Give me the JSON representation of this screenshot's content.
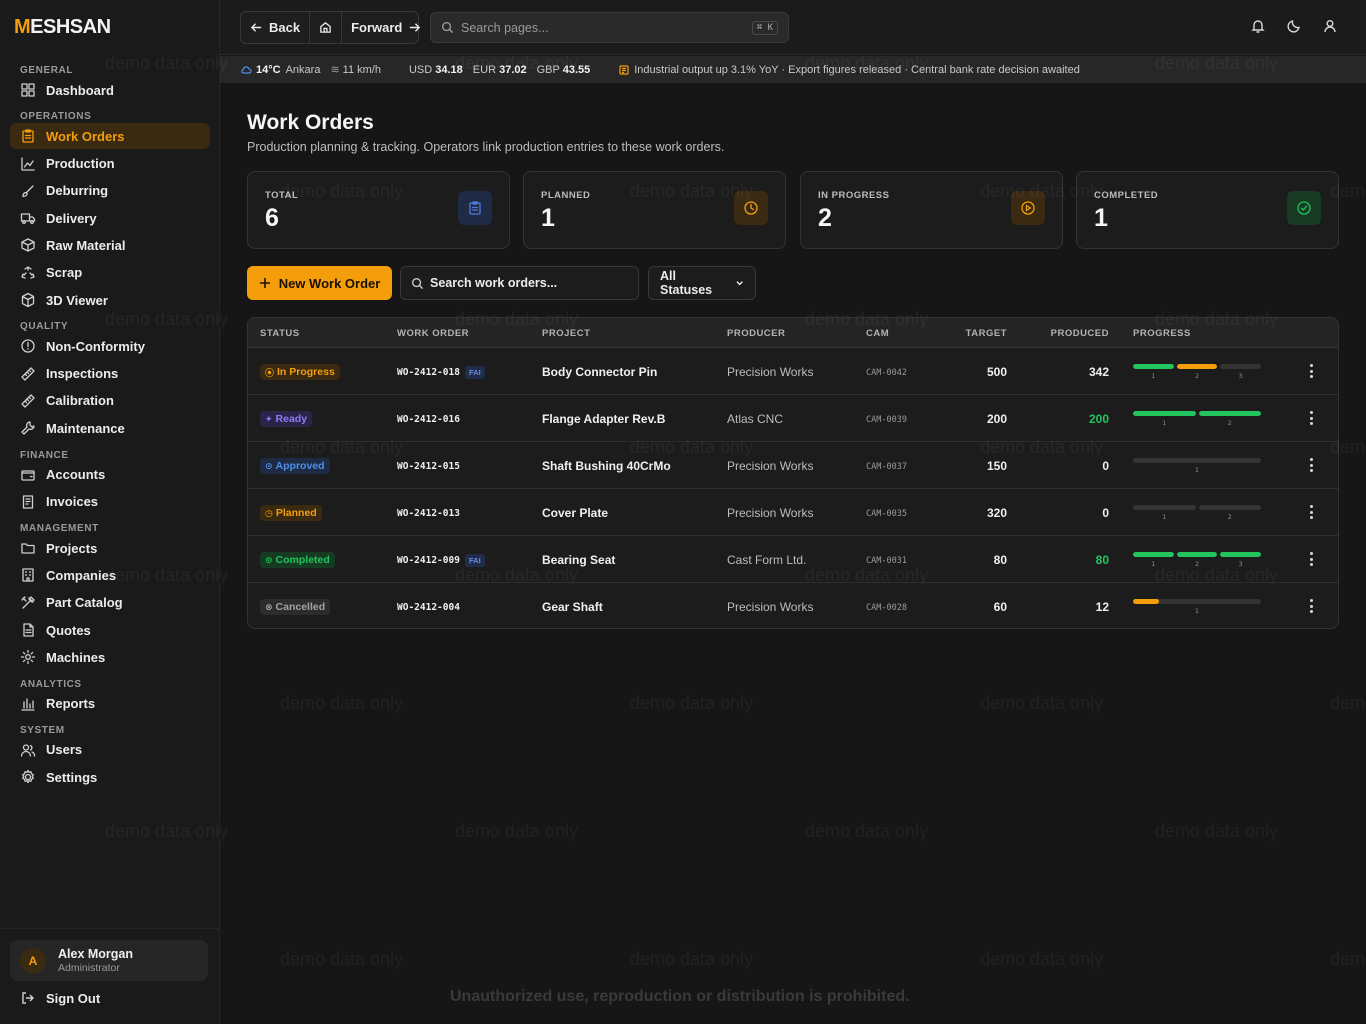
{
  "app": {
    "logo_prefix": "M",
    "logo_rest": "ESHSAN"
  },
  "sidebar": {
    "sections": [
      {
        "title": "GENERAL",
        "items": [
          {
            "label": "Dashboard",
            "icon": "dashboard-icon"
          }
        ]
      },
      {
        "title": "OPERATIONS",
        "items": [
          {
            "label": "Work Orders",
            "icon": "clipboard-icon",
            "active": true
          },
          {
            "label": "Production",
            "icon": "chart-icon"
          },
          {
            "label": "Deburring",
            "icon": "brush-icon"
          },
          {
            "label": "Delivery",
            "icon": "truck-icon"
          },
          {
            "label": "Raw Material",
            "icon": "box-icon"
          },
          {
            "label": "Scrap",
            "icon": "recycle-icon"
          },
          {
            "label": "3D Viewer",
            "icon": "cube-icon"
          }
        ]
      },
      {
        "title": "QUALITY",
        "items": [
          {
            "label": "Non-Conformity",
            "icon": "alert-circle-icon"
          },
          {
            "label": "Inspections",
            "icon": "ruler-icon"
          },
          {
            "label": "Calibration",
            "icon": "ruler-icon"
          },
          {
            "label": "Maintenance",
            "icon": "wrench-icon"
          }
        ]
      },
      {
        "title": "FINANCE",
        "items": [
          {
            "label": "Accounts",
            "icon": "wallet-icon"
          },
          {
            "label": "Invoices",
            "icon": "receipt-icon"
          }
        ]
      },
      {
        "title": "MANAGEMENT",
        "items": [
          {
            "label": "Projects",
            "icon": "folder-icon"
          },
          {
            "label": "Companies",
            "icon": "building-icon"
          },
          {
            "label": "Part Catalog",
            "icon": "tools-icon"
          },
          {
            "label": "Quotes",
            "icon": "file-icon"
          },
          {
            "label": "Machines",
            "icon": "cog-icon"
          }
        ]
      },
      {
        "title": "ANALYTICS",
        "items": [
          {
            "label": "Reports",
            "icon": "bar-chart-icon"
          }
        ]
      },
      {
        "title": "SYSTEM",
        "items": [
          {
            "label": "Users",
            "icon": "users-icon"
          },
          {
            "label": "Settings",
            "icon": "settings-icon"
          }
        ]
      }
    ],
    "user": {
      "initial": "A",
      "name": "Alex Morgan",
      "role": "Administrator"
    },
    "signout": "Sign Out"
  },
  "topbar": {
    "back": "Back",
    "forward": "Forward",
    "search_placeholder": "Search pages...",
    "shortcut": "⌘ K"
  },
  "ticker": {
    "temp": "14°C",
    "city": "Ankara",
    "wind": "11 km/h",
    "rates": [
      {
        "code": "USD",
        "value": "34.18"
      },
      {
        "code": "EUR",
        "value": "37.02"
      },
      {
        "code": "GBP",
        "value": "43.55"
      }
    ],
    "news": "Industrial output up 3.1% YoY · Export figures released · Central bank rate decision awaited"
  },
  "page": {
    "title": "Work Orders",
    "subtitle": "Production planning & tracking. Operators link production entries to these work orders."
  },
  "stats": [
    {
      "label": "TOTAL",
      "value": "6",
      "icon": "clipboard-icon",
      "color": "#4f7bdc",
      "bg": "#1f2a44"
    },
    {
      "label": "PLANNED",
      "value": "1",
      "icon": "clock-icon",
      "color": "#f59e0b",
      "bg": "#3a2a12"
    },
    {
      "label": "IN PROGRESS",
      "value": "2",
      "icon": "play-icon",
      "color": "#f59e0b",
      "bg": "#3a2a12"
    },
    {
      "label": "COMPLETED",
      "value": "1",
      "icon": "check-circle-icon",
      "color": "#22c55e",
      "bg": "#163a22"
    }
  ],
  "toolbar": {
    "new_label": "New Work Order",
    "search_placeholder": "Search work orders...",
    "status_filter": "All Statuses"
  },
  "table": {
    "headers": [
      "STATUS",
      "WORK ORDER",
      "PROJECT",
      "PRODUCER",
      "CAM",
      "TARGET",
      "PRODUCED",
      "PROGRESS"
    ],
    "rows": [
      {
        "status": "In Progress",
        "status_icon": "⦿",
        "status_color": "#f59e0b",
        "status_bg": "#3a2a12",
        "wo": "WO-2412-018",
        "fai": "FAI",
        "project": "Body Connector Pin",
        "producer": "Precision Works",
        "cam": "CAM-0042",
        "target": "500",
        "produced": "342",
        "produced_green": false,
        "segments": [
          {
            "n": "1",
            "fill": 1.0,
            "color": "#22c55e"
          },
          {
            "n": "2",
            "fill": 1.0,
            "color": "#f59e0b"
          },
          {
            "n": "3",
            "fill": 0,
            "color": "#343434"
          }
        ]
      },
      {
        "status": "Ready",
        "status_icon": "✦",
        "status_color": "#8b7cf6",
        "status_bg": "#2a2448",
        "wo": "WO-2412-016",
        "fai": "",
        "project": "Flange Adapter Rev.B",
        "producer": "Atlas CNC",
        "cam": "CAM-0039",
        "target": "200",
        "produced": "200",
        "produced_green": true,
        "segments": [
          {
            "n": "1",
            "fill": 1.0,
            "color": "#22c55e"
          },
          {
            "n": "2",
            "fill": 1.0,
            "color": "#22c55e"
          }
        ]
      },
      {
        "status": "Approved",
        "status_icon": "⊙",
        "status_color": "#4f8fe8",
        "status_bg": "#1d2c44",
        "wo": "WO-2412-015",
        "fai": "",
        "project": "Shaft Bushing 40CrMo",
        "producer": "Precision Works",
        "cam": "CAM-0037",
        "target": "150",
        "produced": "0",
        "produced_green": false,
        "segments": [
          {
            "n": "1",
            "fill": 0,
            "color": "#343434"
          }
        ]
      },
      {
        "status": "Planned",
        "status_icon": "◷",
        "status_color": "#f59e0b",
        "status_bg": "#3a2a12",
        "wo": "WO-2412-013",
        "fai": "",
        "project": "Cover Plate",
        "producer": "Precision Works",
        "cam": "CAM-0035",
        "target": "320",
        "produced": "0",
        "produced_green": false,
        "segments": [
          {
            "n": "1",
            "fill": 0,
            "color": "#343434"
          },
          {
            "n": "2",
            "fill": 0,
            "color": "#343434"
          }
        ]
      },
      {
        "status": "Completed",
        "status_icon": "⊙",
        "status_color": "#22c55e",
        "status_bg": "#163a22",
        "wo": "WO-2412-009",
        "fai": "FAI",
        "project": "Bearing Seat",
        "producer": "Cast Form Ltd.",
        "cam": "CAM-0031",
        "target": "80",
        "produced": "80",
        "produced_green": true,
        "segments": [
          {
            "n": "1",
            "fill": 1.0,
            "color": "#22c55e"
          },
          {
            "n": "2",
            "fill": 1.0,
            "color": "#22c55e"
          },
          {
            "n": "3",
            "fill": 1.0,
            "color": "#22c55e"
          }
        ]
      },
      {
        "status": "Cancelled",
        "status_icon": "⊗",
        "status_color": "#a3a3a3",
        "status_bg": "#2c2c2c",
        "wo": "WO-2412-004",
        "fai": "",
        "project": "Gear Shaft",
        "producer": "Precision Works",
        "cam": "CAM-0028",
        "target": "60",
        "produced": "12",
        "produced_green": false,
        "segments": [
          {
            "n": "1",
            "fill": 0.2,
            "color": "#f59e0b"
          }
        ]
      }
    ]
  },
  "watermark": "demo data only",
  "footer": "Unauthorized use, reproduction or distribution is prohibited."
}
